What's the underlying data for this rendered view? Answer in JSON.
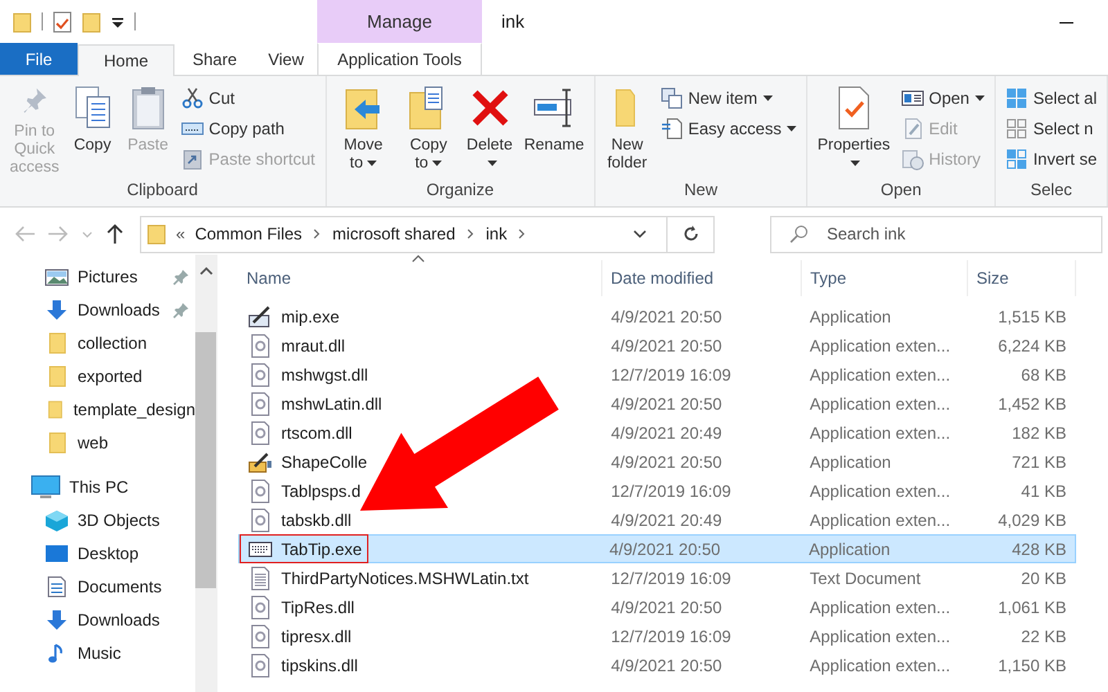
{
  "window": {
    "title": "ink",
    "context_header": "Manage"
  },
  "ribbon_tabs": [
    {
      "label": "File",
      "kind": "file",
      "selected": false
    },
    {
      "label": "Home",
      "kind": "tab",
      "selected": true
    },
    {
      "label": "Share",
      "kind": "tab",
      "selected": false
    },
    {
      "label": "View",
      "kind": "tab",
      "selected": false
    },
    {
      "label": "Application Tools",
      "kind": "contextual",
      "selected": false
    }
  ],
  "ribbon": {
    "groups": [
      {
        "label": "Clipboard",
        "items": [
          {
            "kind": "large",
            "label": "Pin to Quick access",
            "disabled": true,
            "dropdown": false
          },
          {
            "kind": "large",
            "label": "Copy",
            "disabled": false,
            "dropdown": false
          },
          {
            "kind": "large",
            "label": "Paste",
            "disabled": true,
            "dropdown": false
          },
          {
            "kind": "stack",
            "buttons": [
              {
                "label": "Cut",
                "disabled": false,
                "dropdown": false
              },
              {
                "label": "Copy path",
                "disabled": false,
                "dropdown": false
              },
              {
                "label": "Paste shortcut",
                "disabled": true,
                "dropdown": false
              }
            ]
          }
        ]
      },
      {
        "label": "Organize",
        "items": [
          {
            "kind": "large",
            "label": "Move to",
            "disabled": false,
            "dropdown": true
          },
          {
            "kind": "large",
            "label": "Copy to",
            "disabled": false,
            "dropdown": true
          },
          {
            "kind": "large",
            "label": "Delete",
            "disabled": false,
            "dropdown": true
          },
          {
            "kind": "large",
            "label": "Rename",
            "disabled": false,
            "dropdown": false
          }
        ]
      },
      {
        "label": "New",
        "items": [
          {
            "kind": "large",
            "label": "New folder",
            "disabled": false,
            "dropdown": false
          },
          {
            "kind": "stack",
            "buttons": [
              {
                "label": "New item",
                "disabled": false,
                "dropdown": true
              },
              {
                "label": "Easy access",
                "disabled": false,
                "dropdown": true
              }
            ]
          }
        ]
      },
      {
        "label": "Open",
        "items": [
          {
            "kind": "large",
            "label": "Properties",
            "disabled": false,
            "dropdown": true
          },
          {
            "kind": "stack",
            "buttons": [
              {
                "label": "Open",
                "disabled": false,
                "dropdown": true
              },
              {
                "label": "Edit",
                "disabled": true,
                "dropdown": false
              },
              {
                "label": "History",
                "disabled": true,
                "dropdown": false
              }
            ]
          }
        ]
      },
      {
        "label": "Selec",
        "items": [
          {
            "kind": "stack",
            "buttons": [
              {
                "label": "Select al",
                "disabled": false,
                "dropdown": false
              },
              {
                "label": "Select n",
                "disabled": false,
                "dropdown": false
              },
              {
                "label": "Invert se",
                "disabled": false,
                "dropdown": false
              }
            ]
          }
        ]
      }
    ]
  },
  "address_bar": {
    "prefix": "«",
    "path": [
      "Common Files",
      "microsoft shared",
      "ink"
    ]
  },
  "search": {
    "placeholder": "Search ink"
  },
  "nav_pane": {
    "quick_access": [
      {
        "label": "Pictures",
        "pinned": true
      },
      {
        "label": "Downloads",
        "pinned": true
      },
      {
        "label": "collection",
        "pinned": false
      },
      {
        "label": "exported",
        "pinned": false
      },
      {
        "label": "template_design",
        "pinned": false
      },
      {
        "label": "web",
        "pinned": false
      }
    ],
    "this_pc": {
      "label": "This PC",
      "children": [
        {
          "label": "3D Objects"
        },
        {
          "label": "Desktop"
        },
        {
          "label": "Documents"
        },
        {
          "label": "Downloads"
        },
        {
          "label": "Music"
        }
      ]
    }
  },
  "file_list": {
    "columns": [
      "Name",
      "Date modified",
      "Type",
      "Size"
    ],
    "rows": [
      {
        "name": "mip.exe",
        "date": "4/9/2021 20:50",
        "type": "Application",
        "size": "1,515 KB",
        "selected": false,
        "outlined": false
      },
      {
        "name": "mraut.dll",
        "date": "4/9/2021 20:50",
        "type": "Application exten...",
        "size": "6,224 KB",
        "selected": false,
        "outlined": false
      },
      {
        "name": "mshwgst.dll",
        "date": "12/7/2019 16:09",
        "type": "Application exten...",
        "size": "68 KB",
        "selected": false,
        "outlined": false
      },
      {
        "name": "mshwLatin.dll",
        "date": "4/9/2021 20:50",
        "type": "Application exten...",
        "size": "1,452 KB",
        "selected": false,
        "outlined": false
      },
      {
        "name": "rtscom.dll",
        "date": "4/9/2021 20:49",
        "type": "Application exten...",
        "size": "182 KB",
        "selected": false,
        "outlined": false
      },
      {
        "name": "ShapeColle",
        "date": "4/9/2021 20:50",
        "type": "Application",
        "size": "721 KB",
        "selected": false,
        "outlined": false
      },
      {
        "name": "Tablpsps.d",
        "date": "12/7/2019 16:09",
        "type": "Application exten...",
        "size": "41 KB",
        "selected": false,
        "outlined": false
      },
      {
        "name": "tabskb.dll",
        "date": "4/9/2021 20:49",
        "type": "Application exten...",
        "size": "4,029 KB",
        "selected": false,
        "outlined": false
      },
      {
        "name": "TabTip.exe",
        "date": "4/9/2021 20:50",
        "type": "Application",
        "size": "428 KB",
        "selected": true,
        "outlined": true
      },
      {
        "name": "ThirdPartyNotices.MSHWLatin.txt",
        "date": "12/7/2019 16:09",
        "type": "Text Document",
        "size": "20 KB",
        "selected": false,
        "outlined": false
      },
      {
        "name": "TipRes.dll",
        "date": "4/9/2021 20:50",
        "type": "Application exten...",
        "size": "1,061 KB",
        "selected": false,
        "outlined": false
      },
      {
        "name": "tipresx.dll",
        "date": "12/7/2019 16:09",
        "type": "Application exten...",
        "size": "22 KB",
        "selected": false,
        "outlined": false
      },
      {
        "name": "tipskins.dll",
        "date": "4/9/2021 20:50",
        "type": "Application exten...",
        "size": "1,150 KB",
        "selected": false,
        "outlined": false
      }
    ]
  }
}
